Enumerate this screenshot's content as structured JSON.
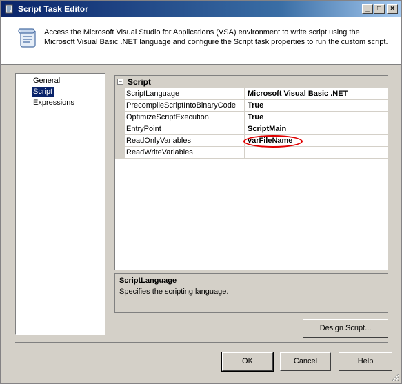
{
  "window": {
    "title": "Script Task Editor",
    "icon": "script-task-icon"
  },
  "titlebar": {
    "minimize": "_",
    "maximize": "□",
    "close": "×"
  },
  "header": {
    "icon": "script-scroll-icon",
    "description": "Access the Microsoft Visual Studio for Applications (VSA) environment to write script using the Microsoft Visual Basic .NET language and configure the Script task properties to run the custom script."
  },
  "nav": {
    "items": [
      {
        "label": "General",
        "selected": false
      },
      {
        "label": "Script",
        "selected": true
      },
      {
        "label": "Expressions",
        "selected": false
      }
    ]
  },
  "grid": {
    "category": {
      "toggle": "⊟",
      "label": "Script"
    },
    "rows": [
      {
        "name": "ScriptLanguage",
        "value": "Microsoft Visual Basic .NET"
      },
      {
        "name": "PrecompileScriptIntoBinaryCode",
        "value": "True"
      },
      {
        "name": "OptimizeScriptExecution",
        "value": "True"
      },
      {
        "name": "EntryPoint",
        "value": "ScriptMain"
      },
      {
        "name": "ReadOnlyVariables",
        "value": "varFileName"
      },
      {
        "name": "ReadWriteVariables",
        "value": ""
      }
    ]
  },
  "description_panel": {
    "title": "ScriptLanguage",
    "text": "Specifies the scripting language."
  },
  "buttons": {
    "design_script": "Design Script...",
    "ok": "OK",
    "cancel": "Cancel",
    "help": "Help"
  },
  "colors": {
    "titlebar": "#0a246a",
    "highlight_ellipse": "#e00000",
    "selection": "#0a246a"
  }
}
